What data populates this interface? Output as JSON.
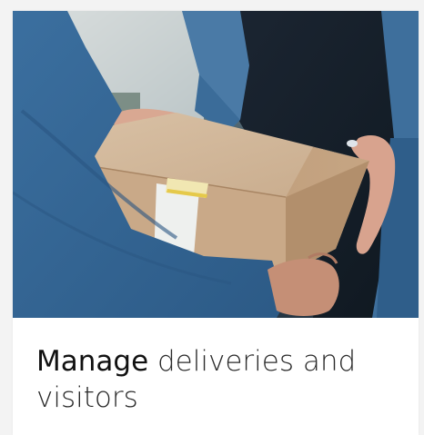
{
  "card": {
    "image_alt": "Delivery person handing a cardboard box to a recipient",
    "title_bold": "Manage",
    "title_rest": " deliveries and visitors"
  }
}
